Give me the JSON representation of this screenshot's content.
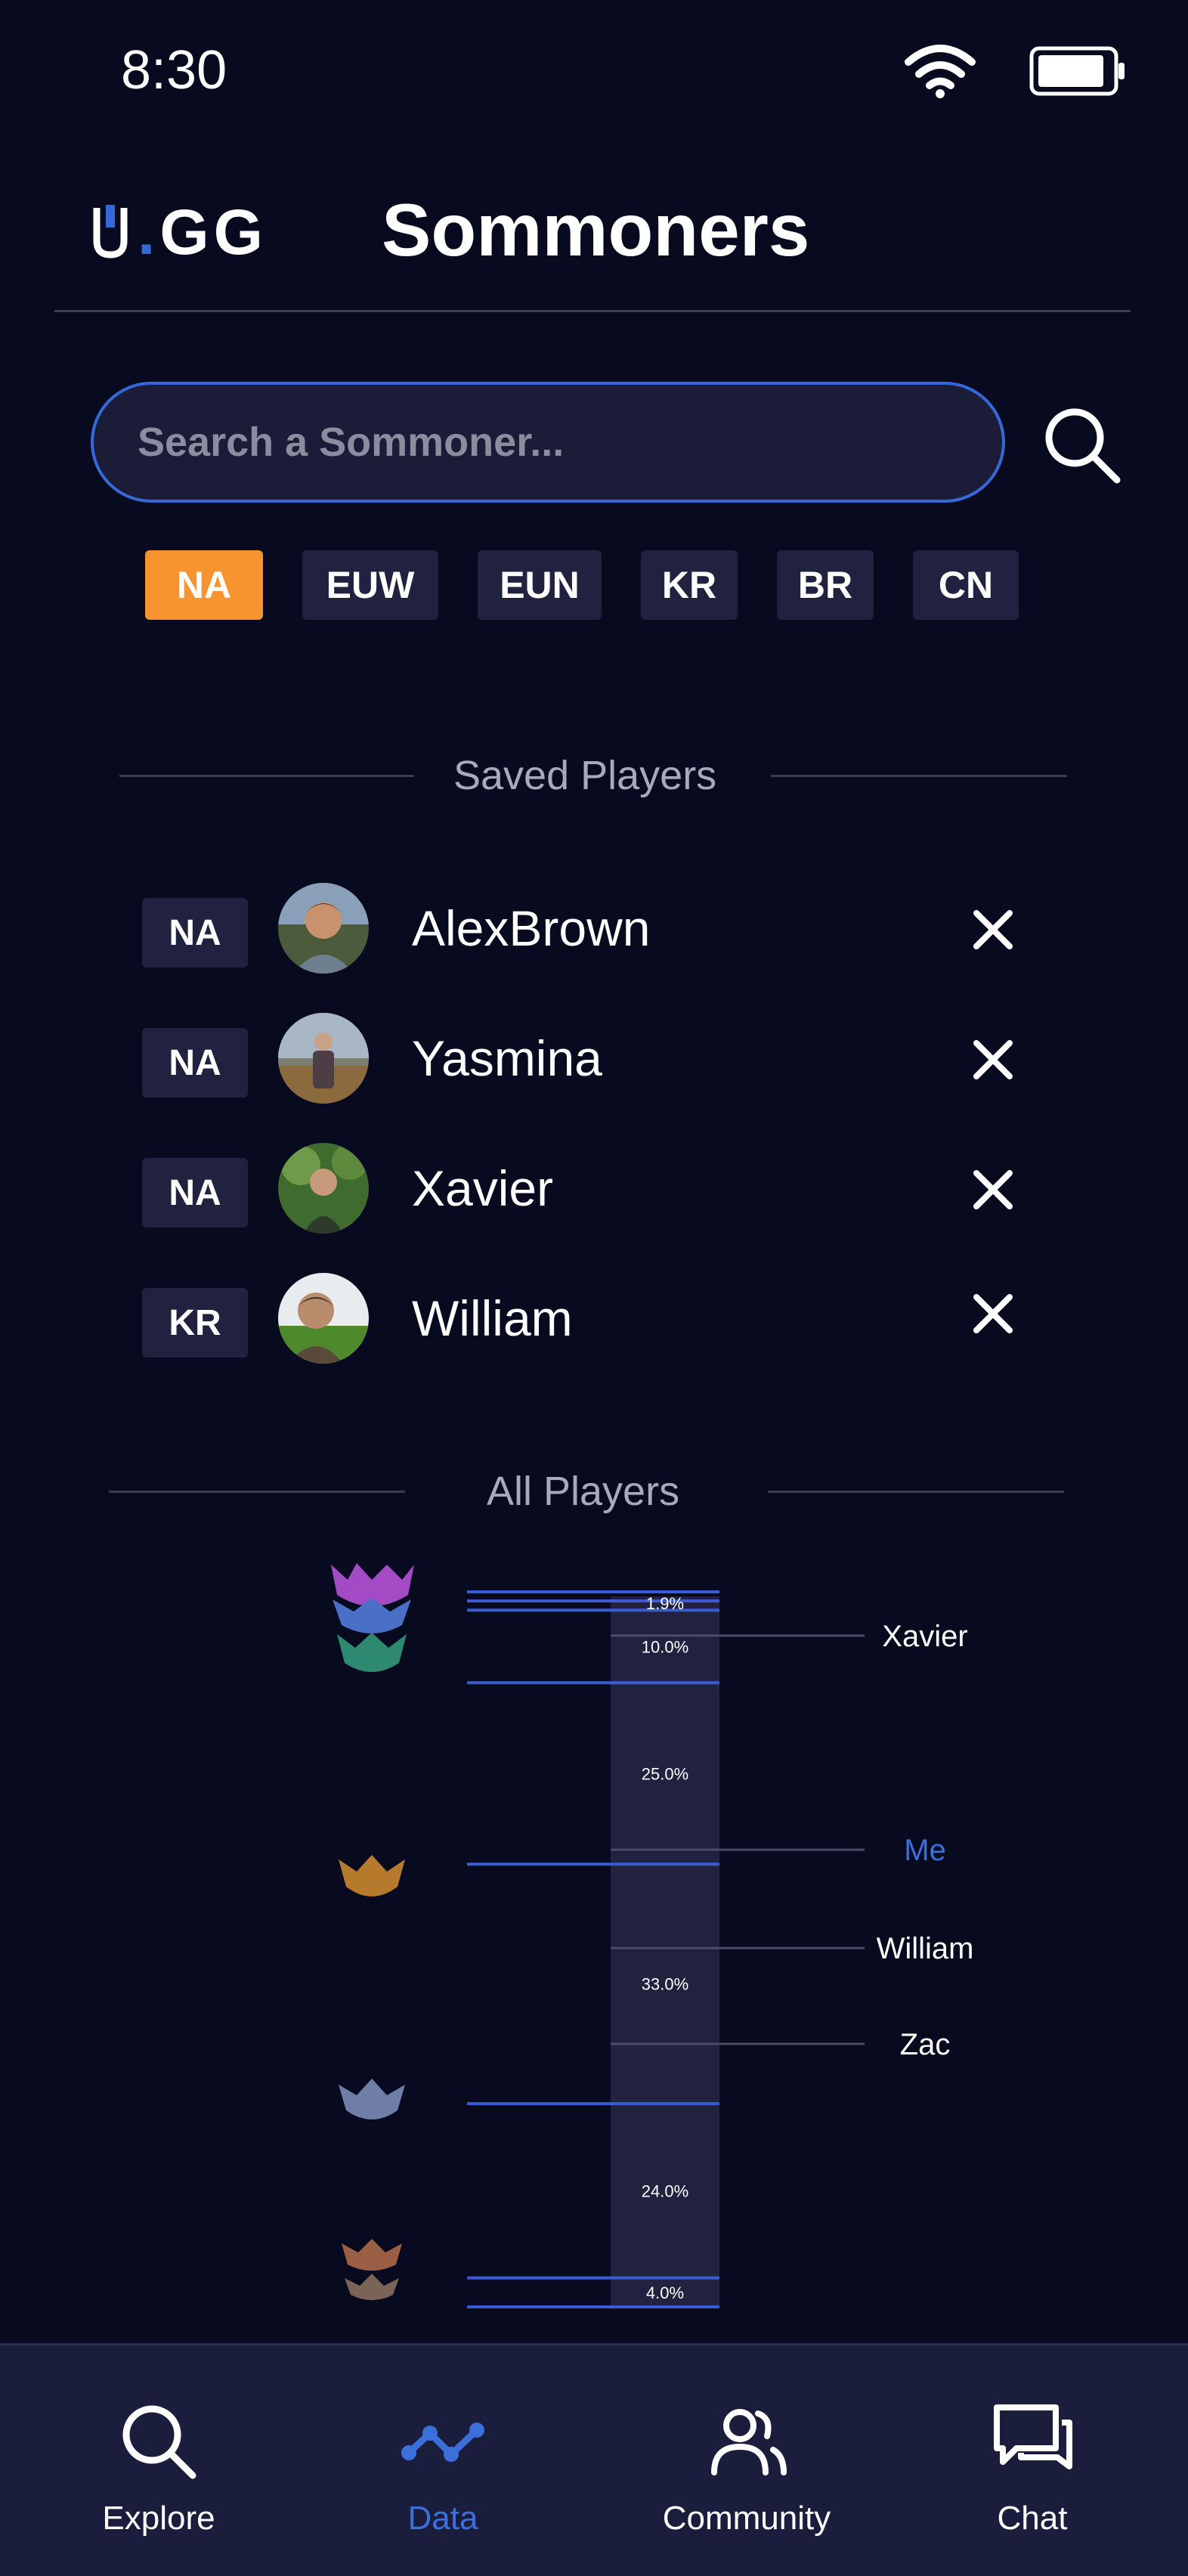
{
  "status_bar": {
    "time": "8:30"
  },
  "header": {
    "logo_text": ".GG",
    "title": "Sommoners"
  },
  "search": {
    "placeholder": "Search a Sommoner..."
  },
  "regions": [
    {
      "label": "NA",
      "active": true
    },
    {
      "label": "EUW",
      "active": false
    },
    {
      "label": "EUN",
      "active": false
    },
    {
      "label": "KR",
      "active": false
    },
    {
      "label": "BR",
      "active": false
    },
    {
      "label": "CN",
      "active": false
    }
  ],
  "saved_players": {
    "heading": "Saved Players",
    "players": [
      {
        "region": "NA",
        "name": "AlexBrown"
      },
      {
        "region": "NA",
        "name": "Yasmina"
      },
      {
        "region": "NA",
        "name": "Xavier"
      },
      {
        "region": "KR",
        "name": "William"
      }
    ]
  },
  "all_players": {
    "heading": "All Players"
  },
  "chart_data": {
    "type": "bar",
    "title": "",
    "tiers": [
      {
        "share": "1.9%",
        "value": 1.9
      },
      {
        "share": "10.0%",
        "value": 10.0
      },
      {
        "share": "25.0%",
        "value": 25.0
      },
      {
        "share": "33.0%",
        "value": 33.0
      },
      {
        "share": "24.0%",
        "value": 24.0
      },
      {
        "share": "4.0%",
        "value": 4.0
      }
    ],
    "player_markers": [
      {
        "name": "Xavier",
        "highlight": false
      },
      {
        "name": "Me",
        "highlight": true
      },
      {
        "name": "William",
        "highlight": false
      },
      {
        "name": "Zac",
        "highlight": false
      }
    ],
    "colors": {
      "bar": "#20223f",
      "tier_line": "#3b5bd6",
      "marker_line": "#4a4d66",
      "highlight": "#3b6fd9"
    }
  },
  "nav": [
    {
      "label": "Explore",
      "icon": "search-icon",
      "active": false
    },
    {
      "label": "Data",
      "icon": "data-icon",
      "active": true
    },
    {
      "label": "Community",
      "icon": "community-icon",
      "active": false
    },
    {
      "label": "Chat",
      "icon": "chat-icon",
      "active": false
    }
  ],
  "colors": {
    "background": "#080a1f",
    "accent": "#3568d8",
    "active_region": "#f7942f",
    "pill": "#20223f"
  }
}
